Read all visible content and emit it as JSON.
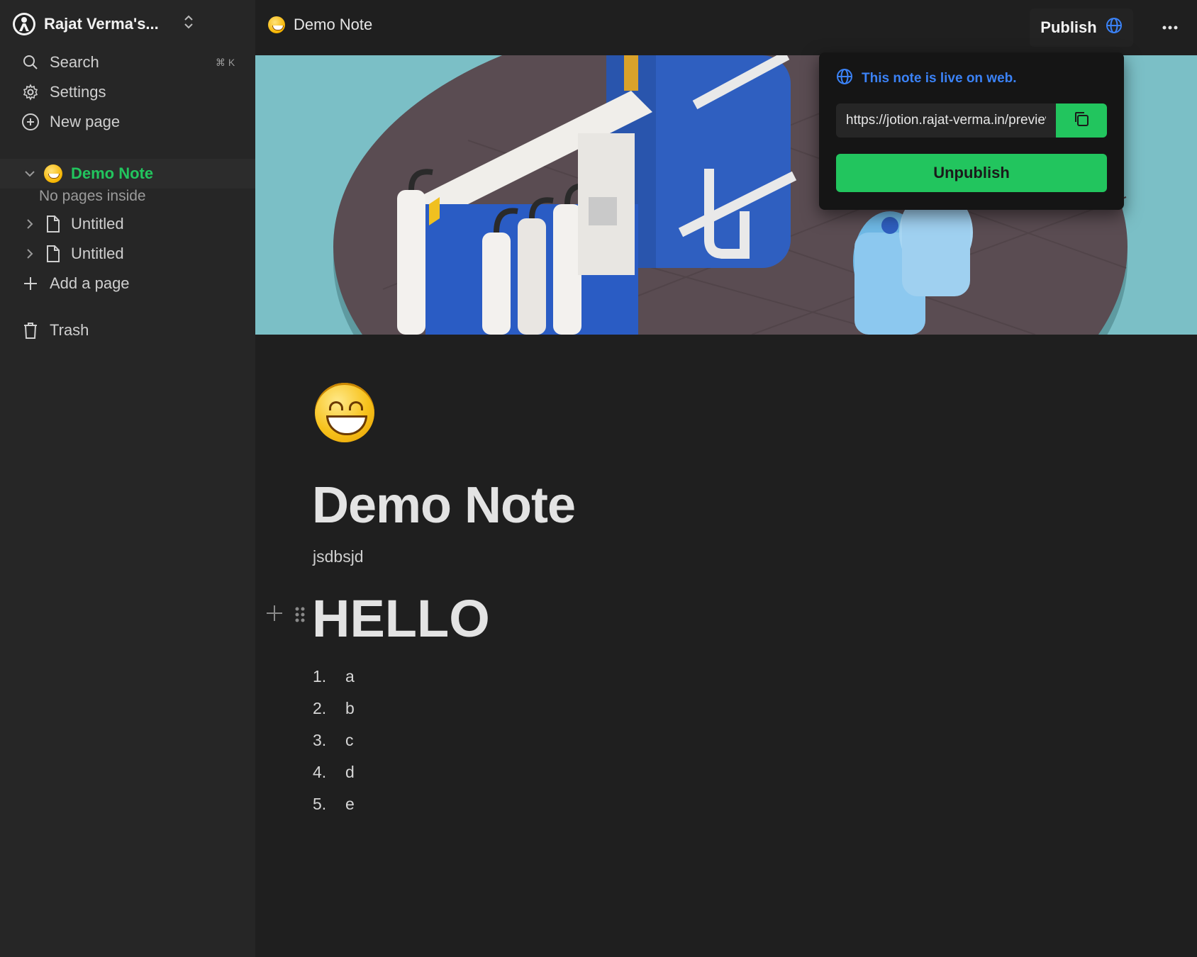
{
  "workspace": {
    "name": "Rajat Verma's..."
  },
  "sidebar": {
    "search_label": "Search",
    "search_shortcut": "⌘ K",
    "settings_label": "Settings",
    "new_page_label": "New page",
    "tree": {
      "active_label": "Demo Note",
      "no_pages_text": "No pages inside",
      "items": [
        {
          "label": "Untitled"
        },
        {
          "label": "Untitled"
        }
      ]
    },
    "add_page_label": "Add a page",
    "trash_label": "Trash"
  },
  "topbar": {
    "breadcrumb_title": "Demo Note",
    "publish_label": "Publish"
  },
  "popover": {
    "live_text": "This note is live on web.",
    "url": "https://jotion.rajat-verma.in/preview/",
    "unpublish_label": "Unpublish"
  },
  "document": {
    "title": "Demo Note",
    "paragraph": "jsdbsjd",
    "heading": "HELLO",
    "list": [
      {
        "num": "1.",
        "text": "a"
      },
      {
        "num": "2.",
        "text": "b"
      },
      {
        "num": "3.",
        "text": "c"
      },
      {
        "num": "4.",
        "text": "d"
      },
      {
        "num": "5.",
        "text": "e"
      }
    ]
  },
  "colors": {
    "accent_green": "#22c55e",
    "link_blue": "#3b82f6",
    "sidebar_bg": "#262626",
    "main_bg": "#1f1f1f"
  },
  "icons": [
    "workspace-logo-icon",
    "chevron-updown-icon",
    "search-icon",
    "gear-icon",
    "plus-circle-icon",
    "chevron-down-icon",
    "chevron-right-icon",
    "file-icon",
    "plus-icon",
    "trash-icon",
    "globe-icon",
    "more-icon",
    "copy-icon",
    "drag-handle-icon"
  ]
}
